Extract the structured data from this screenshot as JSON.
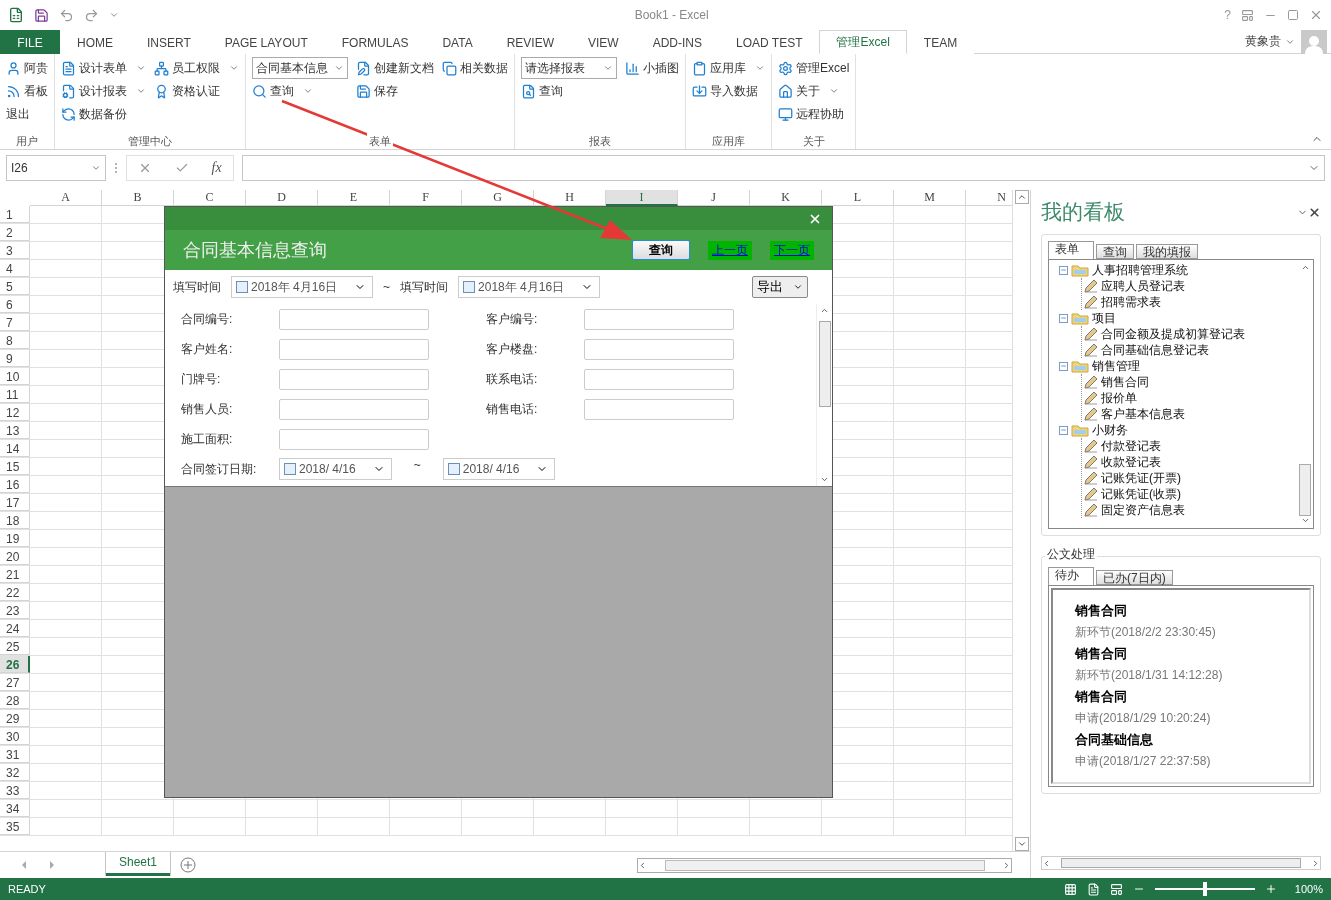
{
  "window": {
    "title": "Book1 - Excel",
    "help": "?"
  },
  "tabs": [
    {
      "label": "FILE",
      "kind": "file",
      "selected": false
    },
    {
      "label": "HOME",
      "kind": "tab",
      "selected": false
    },
    {
      "label": "INSERT",
      "kind": "tab",
      "selected": false
    },
    {
      "label": "PAGE LAYOUT",
      "kind": "tab",
      "selected": false
    },
    {
      "label": "FORMULAS",
      "kind": "tab",
      "selected": false
    },
    {
      "label": "DATA",
      "kind": "tab",
      "selected": false
    },
    {
      "label": "REVIEW",
      "kind": "tab",
      "selected": false
    },
    {
      "label": "VIEW",
      "kind": "tab",
      "selected": false
    },
    {
      "label": "ADD-INS",
      "kind": "tab",
      "selected": false
    },
    {
      "label": "LOAD TEST",
      "kind": "tab",
      "selected": false
    },
    {
      "label": "管理Excel",
      "kind": "tab",
      "selected": true
    },
    {
      "label": "TEAM",
      "kind": "tab",
      "selected": false
    }
  ],
  "user": {
    "name": "黄象贵"
  },
  "ribbon": [
    {
      "label": "用户",
      "columns": [
        [
          {
            "kind": "button",
            "label": "阿贵",
            "caret": false
          },
          {
            "kind": "button",
            "label": "看板",
            "caret": false
          },
          {
            "kind": "button",
            "label": "退出",
            "caret": false
          }
        ]
      ]
    },
    {
      "label": "管理中心",
      "columns": [
        [
          {
            "kind": "button",
            "label": "设计表单",
            "caret": true
          },
          {
            "kind": "button",
            "label": "设计报表",
            "caret": true
          },
          {
            "kind": "button",
            "label": "数据备份",
            "caret": false
          }
        ],
        [
          {
            "kind": "button",
            "label": "员工权限",
            "caret": true
          },
          {
            "kind": "button",
            "label": "资格认证",
            "caret": false
          }
        ]
      ]
    },
    {
      "label": "表单",
      "columns": [
        [
          {
            "kind": "combo",
            "label": "合同基本信息"
          },
          {
            "kind": "button",
            "label": "查询",
            "caret": true
          }
        ],
        [
          {
            "kind": "button",
            "label": "创建新文档",
            "caret": false
          },
          {
            "kind": "button",
            "label": "保存",
            "caret": false
          }
        ],
        [
          {
            "kind": "button",
            "label": "相关数据",
            "caret": false
          }
        ]
      ]
    },
    {
      "label": "报表",
      "columns": [
        [
          {
            "kind": "combo",
            "label": "请选择报表"
          },
          {
            "kind": "button",
            "label": "查询",
            "caret": false
          }
        ],
        [
          {
            "kind": "button",
            "label": "小插图",
            "caret": false
          }
        ]
      ]
    },
    {
      "label": "应用库",
      "columns": [
        [
          {
            "kind": "button",
            "label": "应用库",
            "caret": true
          },
          {
            "kind": "button",
            "label": "导入数据",
            "caret": false
          }
        ]
      ]
    },
    {
      "label": "关于",
      "columns": [
        [
          {
            "kind": "button",
            "label": "管理Excel",
            "caret": false
          },
          {
            "kind": "button",
            "label": "关于",
            "caret": true
          },
          {
            "kind": "button",
            "label": "远程协助",
            "caret": false
          }
        ]
      ]
    }
  ],
  "formula_bar": {
    "name_box": "I26",
    "function_label": "fx"
  },
  "sheet": {
    "columns": [
      {
        "label": "A",
        "selected": false
      },
      {
        "label": "B",
        "selected": false
      },
      {
        "label": "C",
        "selected": false
      },
      {
        "label": "D",
        "selected": false
      },
      {
        "label": "E",
        "selected": false
      },
      {
        "label": "F",
        "selected": false
      },
      {
        "label": "G",
        "selected": false
      },
      {
        "label": "H",
        "selected": false
      },
      {
        "label": "I",
        "selected": true
      },
      {
        "label": "J",
        "selected": false
      },
      {
        "label": "K",
        "selected": false
      },
      {
        "label": "L",
        "selected": false
      },
      {
        "label": "M",
        "selected": false
      },
      {
        "label": "N",
        "selected": false
      }
    ],
    "rows": [
      {
        "label": "1",
        "selected": false
      },
      {
        "label": "2",
        "selected": false
      },
      {
        "label": "3",
        "selected": false
      },
      {
        "label": "4",
        "selected": false
      },
      {
        "label": "5",
        "selected": false
      },
      {
        "label": "6",
        "selected": false
      },
      {
        "label": "7",
        "selected": false
      },
      {
        "label": "8",
        "selected": false
      },
      {
        "label": "9",
        "selected": false
      },
      {
        "label": "10",
        "selected": false
      },
      {
        "label": "11",
        "selected": false
      },
      {
        "label": "12",
        "selected": false
      },
      {
        "label": "13",
        "selected": false
      },
      {
        "label": "14",
        "selected": false
      },
      {
        "label": "15",
        "selected": false
      },
      {
        "label": "16",
        "selected": false
      },
      {
        "label": "17",
        "selected": false
      },
      {
        "label": "18",
        "selected": false
      },
      {
        "label": "19",
        "selected": false
      },
      {
        "label": "20",
        "selected": false
      },
      {
        "label": "21",
        "selected": false
      },
      {
        "label": "22",
        "selected": false
      },
      {
        "label": "23",
        "selected": false
      },
      {
        "label": "24",
        "selected": false
      },
      {
        "label": "25",
        "selected": false
      },
      {
        "label": "26",
        "selected": true
      },
      {
        "label": "27",
        "selected": false
      },
      {
        "label": "28",
        "selected": false
      },
      {
        "label": "29",
        "selected": false
      },
      {
        "label": "30",
        "selected": false
      },
      {
        "label": "31",
        "selected": false
      },
      {
        "label": "32",
        "selected": false
      },
      {
        "label": "33",
        "selected": false
      },
      {
        "label": "34",
        "selected": false
      },
      {
        "label": "35",
        "selected": false
      }
    ]
  },
  "dialog": {
    "title": "合同基本信息查询",
    "buttons": [
      {
        "label": "查询",
        "kind": "button"
      },
      {
        "label": "上一页",
        "kind": "link"
      },
      {
        "label": "下一页",
        "kind": "link"
      }
    ],
    "filter": {
      "from_label": "填写时间",
      "from_date": {
        "value": "2018年  4月16日",
        "checked": false
      },
      "separator": "~",
      "to_label": "填写时间",
      "to_date": {
        "value": "2018年  4月16日",
        "checked": false
      },
      "export": "导出"
    },
    "fields": [
      {
        "label": "合同编号:"
      },
      {
        "label": "客户编号:"
      },
      {
        "label": "客户姓名:"
      },
      {
        "label": "客户楼盘:"
      },
      {
        "label": "门牌号:"
      },
      {
        "label": "联系电话:"
      },
      {
        "label": "销售人员:"
      },
      {
        "label": "销售电话:"
      },
      {
        "label": "施工面积:"
      }
    ],
    "date_range": {
      "label": "合同签订日期:",
      "from": {
        "value": "2018/  4/16",
        "checked": false
      },
      "separator": "~",
      "to": {
        "value": "2018/  4/16",
        "checked": false
      }
    }
  },
  "sheet_tabs": [
    {
      "label": "Sheet1",
      "selected": true
    }
  ],
  "side_panel": {
    "title": "我的看板",
    "tabs": [
      {
        "label": "表单",
        "selected": true
      },
      {
        "label": "查询",
        "selected": false
      },
      {
        "label": "我的填报",
        "selected": false
      }
    ],
    "tree": [
      {
        "label": "人事招聘管理系统",
        "expanded": true,
        "children": [
          {
            "label": "应聘人员登记表"
          },
          {
            "label": "招聘需求表"
          }
        ]
      },
      {
        "label": "项目",
        "expanded": true,
        "children": [
          {
            "label": "合同金额及提成初算登记表"
          },
          {
            "label": "合同基础信息登记表"
          }
        ]
      },
      {
        "label": "销售管理",
        "expanded": true,
        "children": [
          {
            "label": "销售合同"
          },
          {
            "label": "报价单"
          },
          {
            "label": "客户基本信息表"
          }
        ]
      },
      {
        "label": "小财务",
        "expanded": true,
        "children": [
          {
            "label": "付款登记表"
          },
          {
            "label": "收款登记表"
          },
          {
            "label": "记账凭证(开票)"
          },
          {
            "label": "记账凭证(收票)"
          },
          {
            "label": "固定资产信息表"
          }
        ]
      }
    ],
    "docs": {
      "title": "公文处理",
      "tabs": [
        {
          "label": "待办",
          "selected": true
        },
        {
          "label": "已办(7日内)",
          "selected": false
        }
      ],
      "items": [
        {
          "title": "销售合同",
          "detail": "新环节(2018/2/2 23:30:45)"
        },
        {
          "title": "销售合同",
          "detail": "新环节(2018/1/31 14:12:28)"
        },
        {
          "title": "销售合同",
          "detail": "申请(2018/1/29 10:20:24)"
        },
        {
          "title": "合同基础信息",
          "detail": "申请(2018/1/27 22:37:58)"
        }
      ]
    }
  },
  "status_bar": {
    "status": "READY",
    "zoom": {
      "level": 0.5,
      "reading": "100%"
    }
  }
}
